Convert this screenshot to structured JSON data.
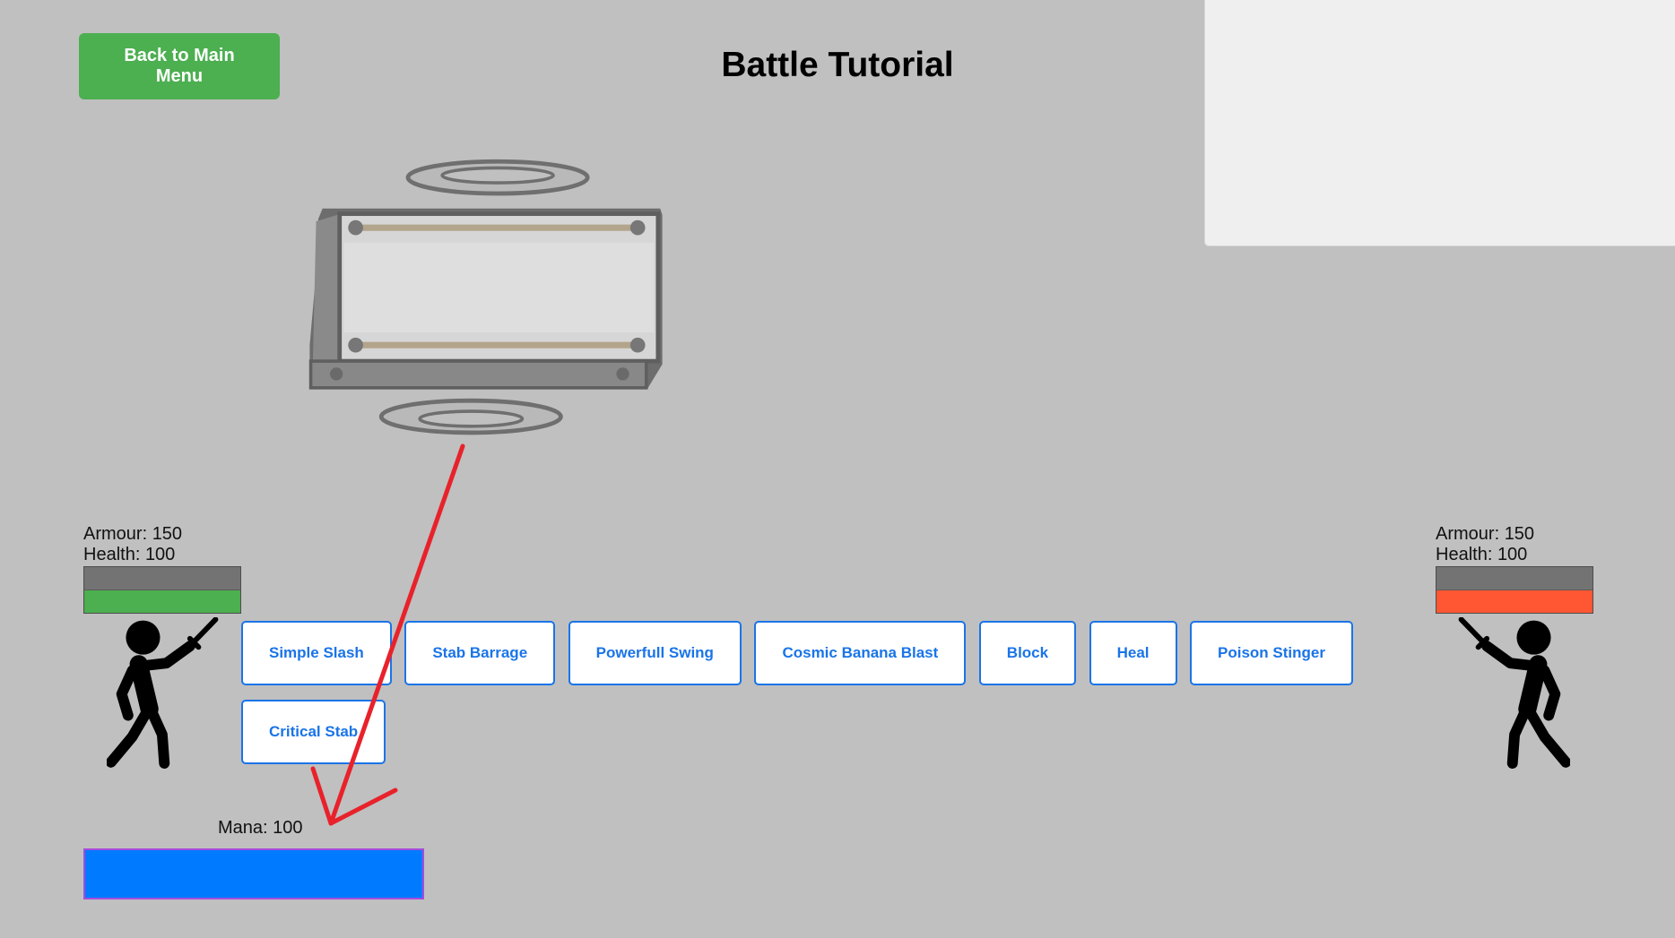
{
  "header": {
    "title": "Battle Tutorial",
    "back_button_label": "Back to Main Menu"
  },
  "player": {
    "armour_label": "Armour:",
    "armour": "150",
    "health_label": "Health:",
    "health": "100",
    "armour_fill": 1,
    "health_fill": 1,
    "mana_label": "Mana:",
    "mana": "100",
    "mana_fill": 1
  },
  "enemy": {
    "armour_label": "Armour:",
    "armour": "150",
    "health_label": "Health:",
    "health": "100",
    "armour_fill": 1,
    "health_fill": 1
  },
  "skills": [
    "Simple Slash",
    "Stab Barrage",
    "Powerfull Swing",
    "Cosmic Banana Blast",
    "Block",
    "Heal",
    "Poison Stinger",
    "Critical Stab"
  ],
  "colors": {
    "background": "#c0c0c0",
    "back_button": "#4CAF50",
    "player_health": "#4CAF50",
    "enemy_health": "#FF5733",
    "armour": "#737373",
    "skill_accent": "#1a74e8",
    "mana": "#007BFF",
    "mana_border": "#a64bdc",
    "arrow": "#e8222b",
    "panel": "#efefef"
  },
  "icons": {
    "player": "stick-figure-swordsman-icon",
    "enemy": "stick-figure-swordsman-icon",
    "sprite": "floating-machine-icon",
    "pointer": "red-arrow-icon"
  }
}
